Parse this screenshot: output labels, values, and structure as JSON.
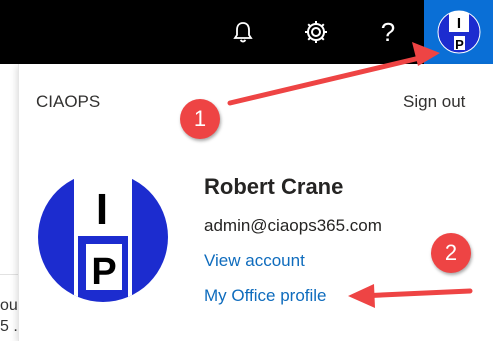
{
  "header": {
    "bell_icon": "bell-icon",
    "settings_icon": "gear-icon",
    "help_label": "?"
  },
  "account_panel": {
    "organization": "CIAOPS",
    "sign_out_label": "Sign out",
    "user_name": "Robert Crane",
    "email": "admin@ciaops365.com",
    "view_account_label": "View account",
    "office_profile_label": "My Office profile"
  },
  "avatar": {
    "top_letter": "I",
    "bottom_letter": "P",
    "colors": {
      "blue": "#1c2ccf",
      "white": "#ffffff"
    }
  },
  "annotations": {
    "badge_1": "1",
    "badge_2": "2",
    "color": "#ee4444"
  },
  "background_text": {
    "line1": "ou",
    "line2": "5 ."
  }
}
